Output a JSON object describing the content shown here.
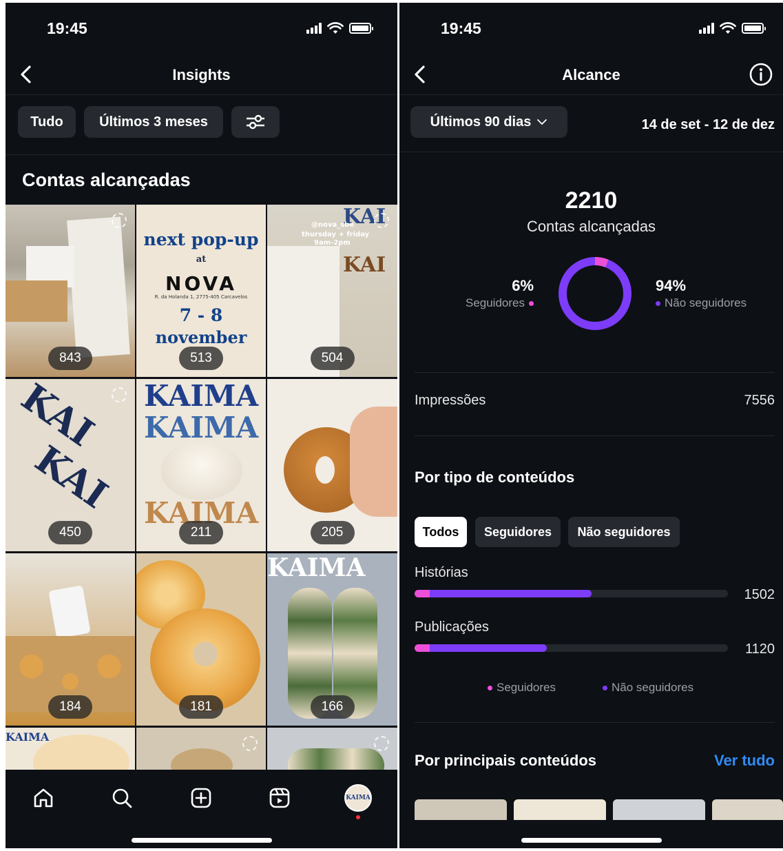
{
  "left": {
    "status": {
      "time": "19:45"
    },
    "header": {
      "title": "Insights"
    },
    "filters": {
      "chip_all": "Tudo",
      "chip_period": "Últimos 3 meses"
    },
    "section_title": "Contas alcançadas",
    "posts": [
      {
        "count": "843"
      },
      {
        "count": "513",
        "text_top": "next pop-up",
        "text_at": "at",
        "text_brand": "NOVA",
        "text_address": "R. da Holanda 1, 2775-405 Carcavelos",
        "text_dates": "7 - 8",
        "text_month": "november"
      },
      {
        "count": "504",
        "text_handle": "@nova_sbe",
        "text_days": "thursday + friday",
        "text_hours": "9am-2pm"
      },
      {
        "count": "450"
      },
      {
        "count": "211",
        "text_brand": "KAIMA"
      },
      {
        "count": "205"
      },
      {
        "count": "184"
      },
      {
        "count": "181"
      },
      {
        "count": "166"
      }
    ],
    "nav": {
      "profile_label": "KAIMA"
    }
  },
  "right": {
    "status": {
      "time": "19:45"
    },
    "header": {
      "title": "Alcance"
    },
    "period": {
      "label": "Últimos 90 dias",
      "range": "14 de set - 12 de dez"
    },
    "reach": {
      "total": "2210",
      "label": "Contas alcançadas",
      "followers_pct": "6%",
      "followers_label": "Seguidores",
      "non_followers_pct": "94%",
      "non_followers_label": "Não seguidores",
      "followers_fraction": 0.06
    },
    "impressions": {
      "label": "Impressões",
      "value": "7556"
    },
    "content_type": {
      "title": "Por tipo de conteúdos",
      "tabs": [
        "Todos",
        "Seguidores",
        "Não seguidores"
      ],
      "rows": [
        {
          "label": "Histórias",
          "value": "1502",
          "total": 1502,
          "followers_fraction": 0.06
        },
        {
          "label": "Publicações",
          "value": "1120",
          "total": 1120,
          "followers_fraction": 0.06
        }
      ],
      "legend_followers": "Seguidores",
      "legend_non_followers": "Não seguidores"
    },
    "top_content": {
      "title": "Por principais conteúdos",
      "link": "Ver tudo"
    }
  },
  "colors": {
    "background": "#0d1015",
    "followers": "#ec4fd8",
    "non_followers": "#7d3cf8",
    "link": "#2f8cf5"
  }
}
